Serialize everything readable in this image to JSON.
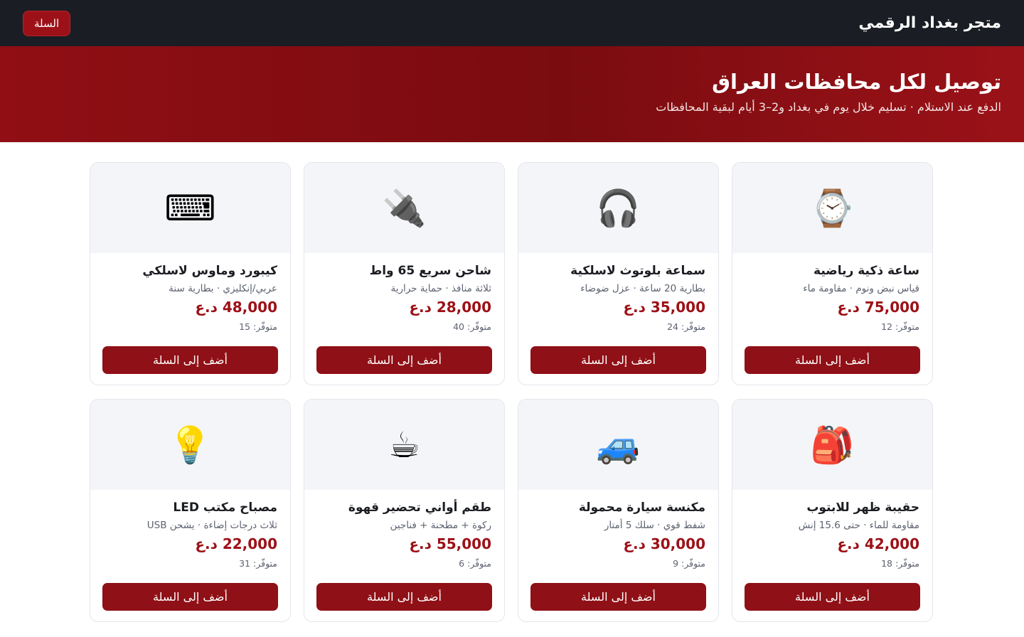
{
  "header": {
    "brand": "متجر بغداد الرقمي",
    "cart_label": "السلة"
  },
  "hero": {
    "title": "توصيل لكل محافظات العراق",
    "subtitle": "الدفع عند الاستلام · تسليم خلال يوم في بغداد و2–3 أيام لبقية المحافظات"
  },
  "add_label": "أضف إلى السلة",
  "products": [
    {
      "icon": "⌚",
      "icon_name": "watch-icon",
      "name": "ساعة ذكية رياضية",
      "desc": "قياس نبض ونوم · مقاومة ماء",
      "price": "75,000 د.ع",
      "stock": "متوفّر: 12"
    },
    {
      "icon": "🎧",
      "icon_name": "headphones-icon",
      "name": "سماعة بلوتوث لاسلكية",
      "desc": "بطارية 20 ساعة · عزل ضوضاء",
      "price": "35,000 د.ع",
      "stock": "متوفّر: 24"
    },
    {
      "icon": "🔌",
      "icon_name": "plug-icon",
      "name": "شاحن سريع 65 واط",
      "desc": "ثلاثة منافذ · حماية حرارية",
      "price": "28,000 د.ع",
      "stock": "متوفّر: 40"
    },
    {
      "icon": "⌨",
      "icon_name": "keyboard-icon",
      "name": "كيبورد وماوس لاسلكي",
      "desc": "عربي/إنكليزي · بطارية سنة",
      "price": "48,000 د.ع",
      "stock": "متوفّر: 15"
    },
    {
      "icon": "🎒",
      "icon_name": "backpack-icon",
      "name": "حقيبة ظهر للابتوب",
      "desc": "مقاومة للماء · حتى 15.6 إنش",
      "price": "42,000 د.ع",
      "stock": "متوفّر: 18"
    },
    {
      "icon": "🚙",
      "icon_name": "car-icon",
      "name": "مكنسة سيارة محمولة",
      "desc": "شفط قوي · سلك 5 أمتار",
      "price": "30,000 د.ع",
      "stock": "متوفّر: 9"
    },
    {
      "icon": "☕",
      "icon_name": "coffee-cup-icon",
      "name": "طقم أواني تحضير قهوة",
      "desc": "ركوة + مطحنة + فناجين",
      "price": "55,000 د.ع",
      "stock": "متوفّر: 6"
    },
    {
      "icon": "💡",
      "icon_name": "light-bulb-icon",
      "name": "مصباح مكتب LED",
      "desc": "ثلاث درجات إضاءة · يشحن USB",
      "price": "22,000 د.ع",
      "stock": "متوفّر: 31"
    }
  ]
}
